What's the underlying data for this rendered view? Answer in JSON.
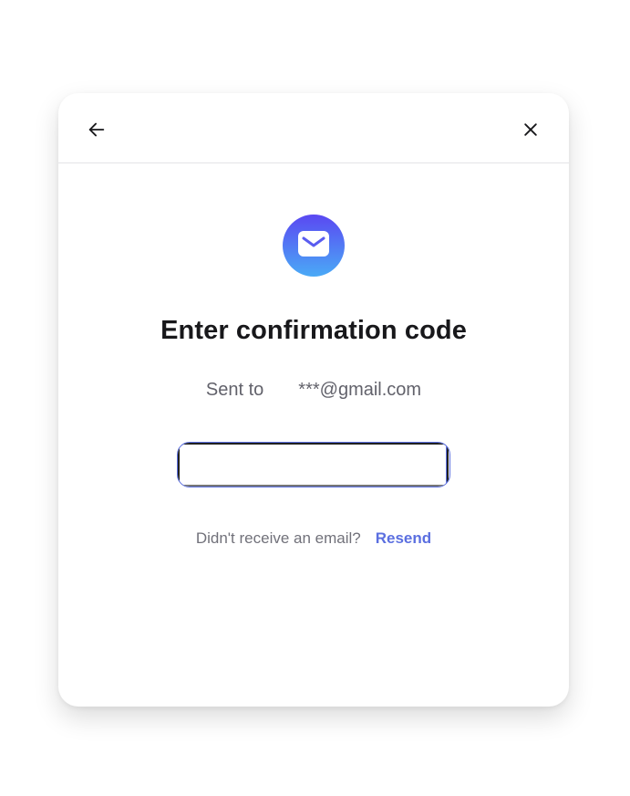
{
  "dialog": {
    "title": "Enter confirmation code",
    "sent_label": "Sent to",
    "email": "***@gmail.com",
    "code_length": 6,
    "resend_prompt": "Didn't receive an email?",
    "resend_label": "Resend"
  },
  "icons": {
    "back": "arrow-left-icon",
    "close": "close-icon",
    "mail": "envelope-icon"
  },
  "colors": {
    "accent": "#5b6fe0",
    "badge_gradient_top": "#5a48f2",
    "badge_gradient_bottom": "#4aaaf6",
    "title_text": "#18181b",
    "muted_text": "#71717a"
  }
}
